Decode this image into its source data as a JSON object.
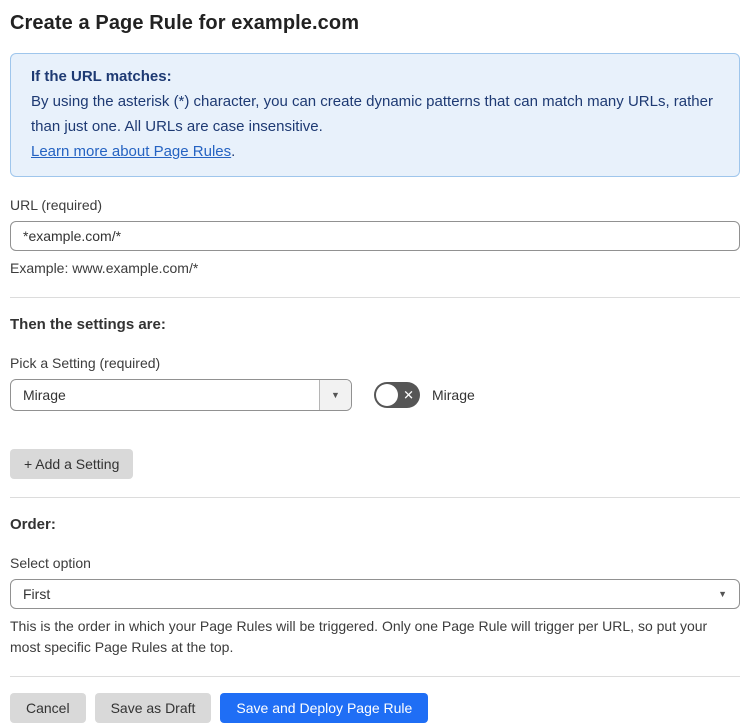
{
  "page": {
    "title": "Create a Page Rule for example.com"
  },
  "info_box": {
    "heading": "If the URL matches:",
    "body": "By using the asterisk (*) character, you can create dynamic patterns that can match many URLs, rather than just one. All URLs are case insensitive.",
    "link_label": "Learn more about Page Rules",
    "link_suffix": "."
  },
  "url_field": {
    "label": "URL (required)",
    "value": "*example.com/*",
    "helper": "Example: www.example.com/*"
  },
  "settings_section": {
    "heading": "Then the settings are:",
    "setting_label": "Pick a Setting (required)",
    "setting_selected_value": "Mirage",
    "toggle_state": "off",
    "toggle_label": "Mirage",
    "add_button_label": "+ Add a Setting"
  },
  "order_section": {
    "heading": "Order:",
    "select_label": "Select option",
    "select_selected_value": "First",
    "helper": "This is the order in which your Page Rules will be triggered. Only one Page Rule will trigger per URL, so put your most specific Page Rules at the top."
  },
  "footer": {
    "cancel_label": "Cancel",
    "save_draft_label": "Save as Draft",
    "save_deploy_label": "Save and Deploy Page Rule"
  },
  "colors": {
    "info_bg": "#e8f1fb",
    "info_border": "#9fc6ec",
    "info_text": "#1e3a73",
    "link": "#2563c2",
    "primary_button": "#1f6ef5",
    "gray_button": "#d9d9d9",
    "toggle_off": "#565656"
  },
  "icons": {
    "dropdown_arrow": "▼",
    "toggle_x": "✕"
  }
}
